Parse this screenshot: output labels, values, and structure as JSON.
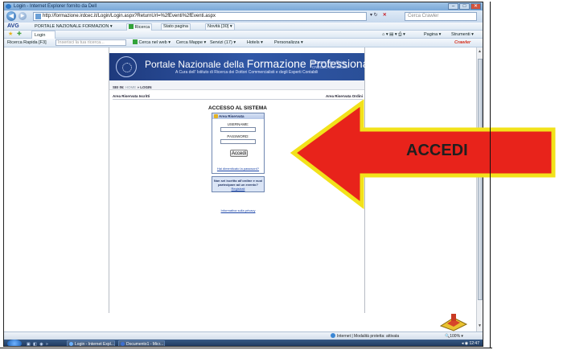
{
  "window": {
    "title": "Login - Internet Explorer fornito da Dell"
  },
  "address_bar": {
    "url": "http://formazione.irdcec.it/Login/Login.aspx?ReturnUrl=%2fEventi%2fEventi.aspx",
    "search_placeholder": "Cerca Crawler"
  },
  "avg_toolbar": {
    "brand": "AVG",
    "portal_label": "PORTALE NAZIONALE FORMAZION",
    "search_label": "Ricerca",
    "page_status_label": "Stato pagina",
    "news_label": "Novità [30]"
  },
  "tab_bar": {
    "tab_label": "Login",
    "page_menu": "Pagina",
    "tools_menu": "Strumenti"
  },
  "crawler_toolbar": {
    "quick_search": "Ricerca Rapida [F3]",
    "search_placeholder": "Inserisci la tua ricerca...",
    "web_search": "Cerca nel web",
    "maps": "Cerca Mappe",
    "services": "Servizi (17)",
    "hotels": "Hotels",
    "personalize": "Personalizza",
    "brand": "Crawler"
  },
  "site": {
    "title_prefix": "Portale Nazionale della",
    "title_main": "Formazione Professionale Continua",
    "subtitle": "A Cura dell' Istituto di Ricerca dei Dottori Commercialisti e degli Esperti Contabili",
    "links": [
      "IRDCEC Sito ufficiale",
      "CNDCEC Sito ufficiale"
    ],
    "breadcrumb_label": "SEI IN:",
    "breadcrumb_home": "HOME",
    "breadcrumb_current": "» LOGIN",
    "area_left": "Area Riservata Iscritti",
    "area_right": "Area Riservata Ordini"
  },
  "login": {
    "title": "ACCESSO AL SISTEMA",
    "box_header": "Area Riservata",
    "username_label": "USERNAME:",
    "password_label": "PASSWORD:",
    "submit": "Accedi",
    "forgot": "Hai dimenticato la password?",
    "register_text": "Non sei iscritto all'ordine e vuoi partecipare ad un evento?",
    "register_link": "Registrati",
    "privacy": "Informativa sulla privacy"
  },
  "annotation": {
    "arrow_label": "ACCEDI",
    "arrow_fill": "#e8231b",
    "arrow_border": "#f2e21a"
  },
  "status_bar": {
    "zone": "Internet | Modalità protetta: attivata",
    "zoom": "100%"
  },
  "taskbar": {
    "task1": "Login - Internet Expl...",
    "task2": "Documento1 - Micr...",
    "clock": "12:47"
  }
}
